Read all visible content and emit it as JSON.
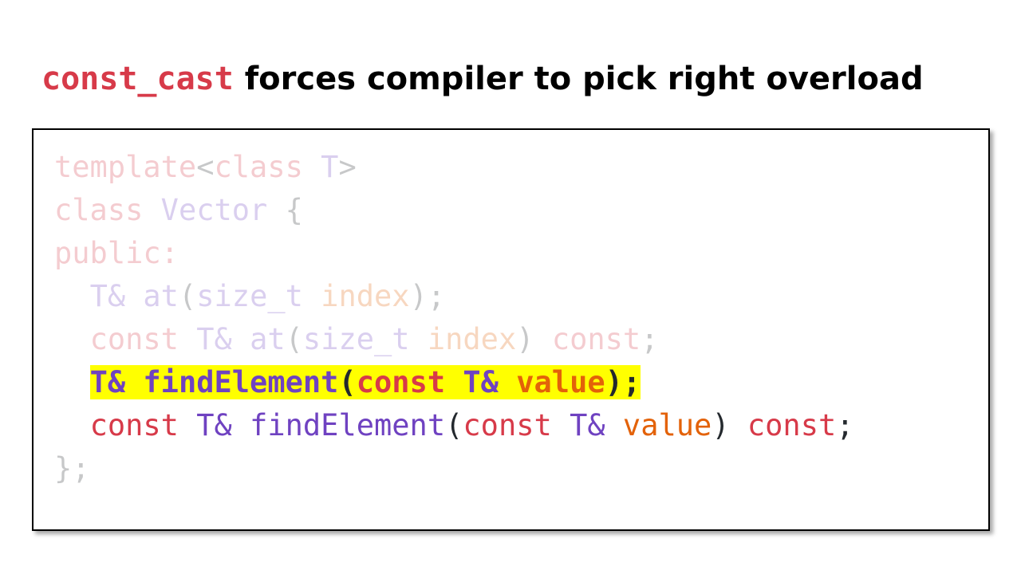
{
  "title": {
    "code": "const_cast",
    "text": " forces compiler to pick right overload"
  },
  "colors": {
    "red": "#d73a49",
    "purple": "#6f42c1",
    "orange": "#e36209",
    "plain": "#24292e",
    "highlight": "#ffff00"
  },
  "code_lines": [
    {
      "faded": true,
      "tokens": [
        [
          "template",
          "red"
        ],
        [
          "<",
          "plain"
        ],
        [
          "class",
          "red"
        ],
        [
          " ",
          "plain"
        ],
        [
          "T",
          "purple"
        ],
        [
          ">",
          "plain"
        ]
      ]
    },
    {
      "faded": true,
      "tokens": [
        [
          "class",
          "red"
        ],
        [
          " ",
          "plain"
        ],
        [
          "Vector",
          "purple"
        ],
        [
          " {",
          "plain"
        ]
      ]
    },
    {
      "faded": true,
      "tokens": [
        [
          "public:",
          "red"
        ]
      ]
    },
    {
      "faded": true,
      "tokens": [
        [
          "  ",
          "plain"
        ],
        [
          "T&",
          "purple"
        ],
        [
          " ",
          "plain"
        ],
        [
          "at",
          "purple"
        ],
        [
          "(",
          "plain"
        ],
        [
          "size_t",
          "purple"
        ],
        [
          " ",
          "plain"
        ],
        [
          "index",
          "orange"
        ],
        [
          ");",
          "plain"
        ]
      ]
    },
    {
      "faded": true,
      "tokens": [
        [
          "  ",
          "plain"
        ],
        [
          "const",
          "red"
        ],
        [
          " ",
          "plain"
        ],
        [
          "T&",
          "purple"
        ],
        [
          " ",
          "plain"
        ],
        [
          "at",
          "purple"
        ],
        [
          "(",
          "plain"
        ],
        [
          "size_t",
          "purple"
        ],
        [
          " ",
          "plain"
        ],
        [
          "index",
          "orange"
        ],
        [
          ") ",
          "plain"
        ],
        [
          "const",
          "red"
        ],
        [
          ";",
          "plain"
        ]
      ]
    },
    {
      "faded": false,
      "highlight": true,
      "tokens": [
        [
          "T&",
          "purple"
        ],
        [
          " ",
          "plain"
        ],
        [
          "findElement",
          "purple"
        ],
        [
          "(",
          "plain"
        ],
        [
          "const",
          "red"
        ],
        [
          " ",
          "plain"
        ],
        [
          "T&",
          "purple"
        ],
        [
          " ",
          "plain"
        ],
        [
          "value",
          "orange"
        ],
        [
          ");",
          "plain"
        ]
      ]
    },
    {
      "faded": false,
      "tokens": [
        [
          "  ",
          "plain"
        ],
        [
          "const",
          "red"
        ],
        [
          " ",
          "plain"
        ],
        [
          "T&",
          "purple"
        ],
        [
          " ",
          "plain"
        ],
        [
          "findElement",
          "purple"
        ],
        [
          "(",
          "plain"
        ],
        [
          "const",
          "red"
        ],
        [
          " ",
          "plain"
        ],
        [
          "T&",
          "purple"
        ],
        [
          " ",
          "plain"
        ],
        [
          "value",
          "orange"
        ],
        [
          ") ",
          "plain"
        ],
        [
          "const",
          "red"
        ],
        [
          ";",
          "plain"
        ]
      ]
    },
    {
      "faded": true,
      "tokens": [
        [
          "};",
          "plain"
        ]
      ]
    }
  ]
}
